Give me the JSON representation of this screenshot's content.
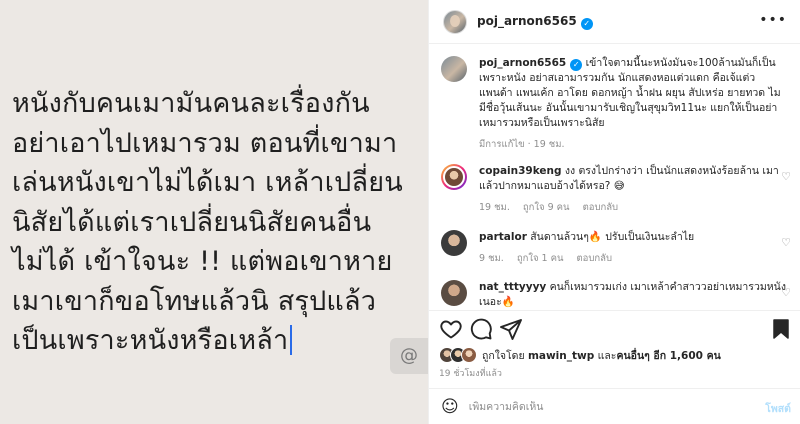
{
  "media": {
    "text": "หนังกับคนเมามันคนละเรื่องกัน\nอย่าเอาไปเหมารวม ตอนที่เขามา\nเล่นหนังเขาไม่ได้เมา เหล้าเปลี่ยน\nนิสัยได้แต่เราเปลี่ยนนิสัยคนอื่น\nไม่ได้ เข้าใจนะ !! แต่พอเขาหาย\nเมาเขาก็ขอโทษแล้วนิ สรุปแล้ว\nเป็นเพราะหนังหรือเหล้า",
    "badge": "@"
  },
  "header": {
    "username": "poj_arnon6565",
    "verified_mark": "✓",
    "more": "•••"
  },
  "caption": {
    "username": "poj_arnon6565",
    "verified_mark": "✓",
    "text": " เข้าใจตามนี้นะหนังมันจะ100ล้านมันก็เป็นเพราะหนัง อย่าสเอามารวมกัน นักแสดงหอแต่วแดก คือเจ้แต่ว แพนด้า แพนเค้ก อาโดย ดอกหญ้า น้ำฝน ผยุน สัปเหร่อ ยายทวด ไมมีชื่อวุ้นเส้นนะ อันนั้นเขามารับเชิญในสุขุมวิท11นะ แยกให้เป็นอย่าเหมารวมหรือเป็นเพราะนิสัย",
    "edited": "มีการแก้ไข · 19 ชม."
  },
  "comments": [
    {
      "username": "copain39keng",
      "text": " งง ตรงไปกร่างว่า เป็นนักแสดงหนังร้อยล้าน เมาแล้วปากหมาแอบอ้างได้หรอ? 😅",
      "time": "19 ชม.",
      "likes": "ถูกใจ 9 คน",
      "reply": "ตอบกลับ"
    },
    {
      "username": "partalor",
      "text": " สันดานล้วนๆ🔥 ปรับเป็นเงินนะลำไย",
      "time": "9 ชม.",
      "likes": "ถูกใจ 1 คน",
      "reply": "ตอบกลับ"
    },
    {
      "username": "nat_tttyyyy",
      "text": " คนก็เหมารวมเก่ง เมาเหล้าคำสาววอย่าเหมารวมหนังเนอะ🔥",
      "time": "",
      "likes": "",
      "reply": ""
    }
  ],
  "likes": {
    "prefix": "ถูกใจโดย ",
    "user": "mawin_twp",
    "middle": " และ",
    "others": "คนอื่นๆ อีก 1,600 คน"
  },
  "time_ago": "19 ชั่วโมงที่แล้ว",
  "comment_box": {
    "placeholder": "เพิ่มความคิดเห็น",
    "post": "โพสต์",
    "emoji_icon": "☺"
  },
  "colors": {
    "verified": "#0095f6",
    "media_bg": "#ece8e4",
    "caret": "#2a6be8"
  }
}
